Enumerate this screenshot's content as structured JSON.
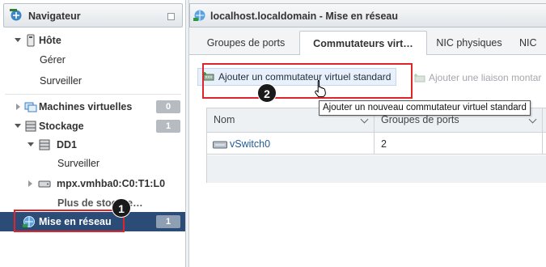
{
  "navigator": {
    "title": "Navigateur",
    "items": [
      {
        "label": "Hôte"
      },
      {
        "label": "Gérer"
      },
      {
        "label": "Surveiller"
      },
      {
        "label": "Machines virtuelles",
        "badge": "0"
      },
      {
        "label": "Stockage",
        "badge": "1"
      },
      {
        "label": "DD1"
      },
      {
        "label": "Surveiller"
      },
      {
        "label": "mpx.vmhba0:C0:T1:L0"
      },
      {
        "label": "Plus de stoc…e…"
      },
      {
        "label": "Mise en réseau",
        "badge": "1"
      }
    ]
  },
  "main": {
    "title": "localhost.localdomain - Mise en réseau",
    "tabs": [
      {
        "label": "Groupes de ports"
      },
      {
        "label": "Commutateurs virt…"
      },
      {
        "label": "NIC physiques"
      },
      {
        "label": "NIC"
      }
    ],
    "toolbar": {
      "add_label": "Ajouter un commutateur virtuel standard",
      "link_label": "Ajouter une liaison montar"
    },
    "tooltip": "Ajouter un nouveau commutateur virtuel standard",
    "table": {
      "columns": [
        "Nom",
        "Groupes de ports"
      ],
      "rows": [
        {
          "name": "vSwitch0",
          "port_groups": "2"
        }
      ]
    }
  },
  "annotations": {
    "marker1": "1",
    "marker2": "2"
  },
  "colors": {
    "selected_row": "#2b4c77",
    "annotation_red": "#e0242b",
    "button_bg": "#e8f1fb"
  }
}
